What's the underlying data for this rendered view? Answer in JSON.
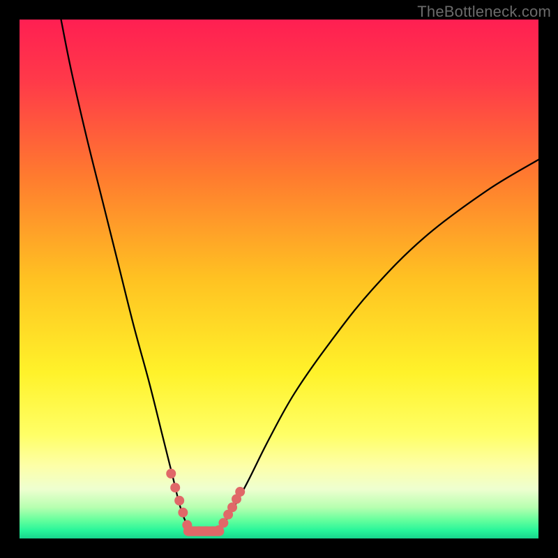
{
  "watermark": "TheBottleneck.com",
  "chart_data": {
    "type": "line",
    "title": "",
    "xlabel": "",
    "ylabel": "",
    "xlim": [
      0,
      100
    ],
    "ylim": [
      0,
      100
    ],
    "background_gradient_stops": [
      {
        "offset": 0,
        "color": "#ff1f52"
      },
      {
        "offset": 0.12,
        "color": "#ff3a49"
      },
      {
        "offset": 0.3,
        "color": "#ff7a2f"
      },
      {
        "offset": 0.5,
        "color": "#ffc222"
      },
      {
        "offset": 0.68,
        "color": "#fff22a"
      },
      {
        "offset": 0.8,
        "color": "#ffff66"
      },
      {
        "offset": 0.86,
        "color": "#fdffa8"
      },
      {
        "offset": 0.905,
        "color": "#eeffd0"
      },
      {
        "offset": 0.94,
        "color": "#b7ffb0"
      },
      {
        "offset": 0.965,
        "color": "#64ff9d"
      },
      {
        "offset": 0.985,
        "color": "#27f59a"
      },
      {
        "offset": 1.0,
        "color": "#18d58d"
      }
    ],
    "series": [
      {
        "name": "curve-left",
        "points": [
          {
            "x": 8.0,
            "y": 100.0
          },
          {
            "x": 10.0,
            "y": 90.0
          },
          {
            "x": 13.0,
            "y": 77.0
          },
          {
            "x": 16.0,
            "y": 65.0
          },
          {
            "x": 19.0,
            "y": 53.0
          },
          {
            "x": 22.0,
            "y": 41.0
          },
          {
            "x": 25.0,
            "y": 30.0
          },
          {
            "x": 27.5,
            "y": 20.0
          },
          {
            "x": 29.5,
            "y": 12.0
          },
          {
            "x": 31.0,
            "y": 6.0
          },
          {
            "x": 32.5,
            "y": 2.3
          },
          {
            "x": 34.0,
            "y": 1.4
          }
        ]
      },
      {
        "name": "curve-right",
        "points": [
          {
            "x": 37.0,
            "y": 1.4
          },
          {
            "x": 39.0,
            "y": 2.6
          },
          {
            "x": 41.0,
            "y": 5.5
          },
          {
            "x": 44.0,
            "y": 11.0
          },
          {
            "x": 48.0,
            "y": 19.0
          },
          {
            "x": 53.0,
            "y": 28.0
          },
          {
            "x": 60.0,
            "y": 38.0
          },
          {
            "x": 68.0,
            "y": 48.0
          },
          {
            "x": 78.0,
            "y": 58.0
          },
          {
            "x": 90.0,
            "y": 67.0
          },
          {
            "x": 100.0,
            "y": 73.0
          }
        ]
      }
    ],
    "flat_segment": {
      "x0": 32.5,
      "x1": 38.5,
      "y": 1.4
    },
    "markers": [
      {
        "x": 29.2,
        "y": 12.5
      },
      {
        "x": 30.0,
        "y": 9.8
      },
      {
        "x": 30.8,
        "y": 7.3
      },
      {
        "x": 31.5,
        "y": 5.0
      },
      {
        "x": 32.3,
        "y": 2.6
      },
      {
        "x": 33.2,
        "y": 1.4
      },
      {
        "x": 34.6,
        "y": 1.4
      },
      {
        "x": 36.0,
        "y": 1.4
      },
      {
        "x": 37.3,
        "y": 1.4
      },
      {
        "x": 38.4,
        "y": 1.6
      },
      {
        "x": 39.3,
        "y": 3.0
      },
      {
        "x": 40.2,
        "y": 4.6
      },
      {
        "x": 41.0,
        "y": 6.0
      },
      {
        "x": 41.8,
        "y": 7.6
      },
      {
        "x": 42.5,
        "y": 9.0
      }
    ],
    "marker_color": "#e06868",
    "marker_radius_px": 7
  }
}
